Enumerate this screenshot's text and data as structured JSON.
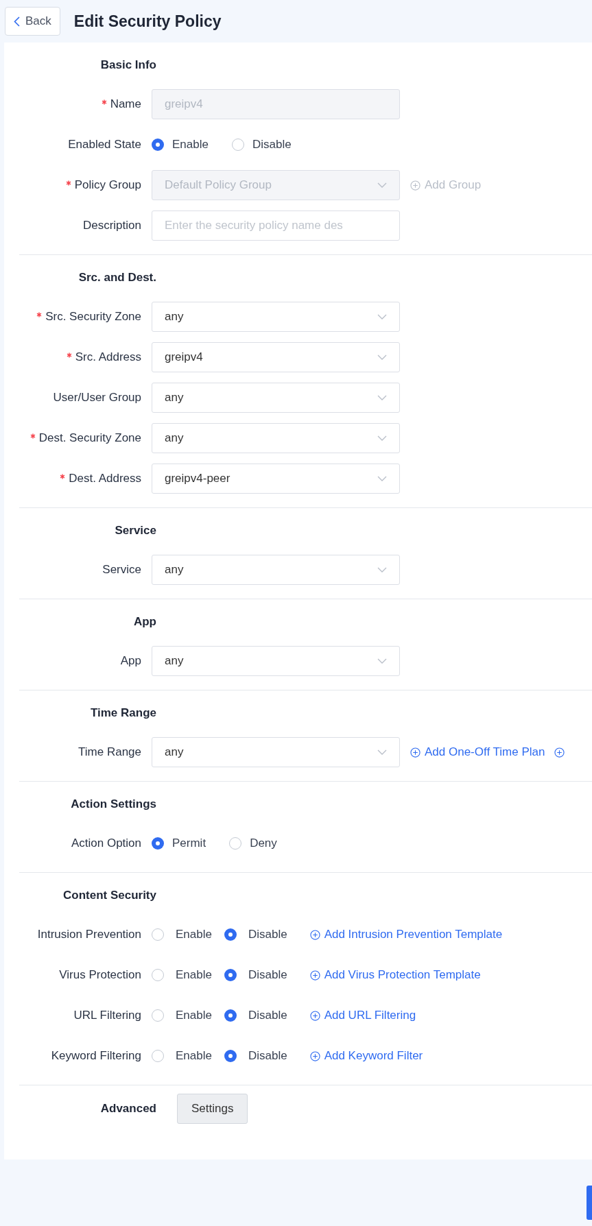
{
  "header": {
    "back": "Back",
    "title": "Edit Security Policy"
  },
  "sections": [
    {
      "kind": "form",
      "title": "Basic Info",
      "rows": [
        {
          "kind": "text",
          "label": "Name",
          "required": true,
          "value": "greipv4",
          "disabled": true
        },
        {
          "kind": "radio",
          "label": "Enabled State",
          "required": false,
          "options": [
            {
              "label": "Enable",
              "selected": true
            },
            {
              "label": "Disable",
              "selected": false
            }
          ]
        },
        {
          "kind": "select",
          "label": "Policy Group",
          "required": true,
          "value": "Default Policy Group",
          "disabled": true,
          "links": [
            {
              "kind": "link",
              "label": "Add Group",
              "disabled": true
            }
          ]
        },
        {
          "kind": "text",
          "label": "Description",
          "required": false,
          "placeholder": "Enter the security policy name des"
        }
      ]
    },
    {
      "kind": "form",
      "title": "Src. and Dest.",
      "rows": [
        {
          "kind": "select",
          "label": "Src. Security Zone",
          "required": true,
          "value": "any",
          "disabled": false
        },
        {
          "kind": "select",
          "label": "Src. Address",
          "required": true,
          "value": "greipv4",
          "disabled": false
        },
        {
          "kind": "select",
          "label": "User/User Group",
          "required": false,
          "value": "any",
          "disabled": false
        },
        {
          "kind": "select",
          "label": "Dest. Security Zone",
          "required": true,
          "value": "any",
          "disabled": false
        },
        {
          "kind": "select",
          "label": "Dest. Address",
          "required": true,
          "value": "greipv4-peer",
          "disabled": false
        }
      ]
    },
    {
      "kind": "form",
      "title": "Service",
      "rows": [
        {
          "kind": "select",
          "label": "Service",
          "required": false,
          "value": "any",
          "disabled": false
        }
      ]
    },
    {
      "kind": "form",
      "title": "App",
      "rows": [
        {
          "kind": "select",
          "label": "App",
          "required": false,
          "value": "any",
          "disabled": false
        }
      ]
    },
    {
      "kind": "form",
      "title": "Time Range",
      "rows": [
        {
          "kind": "select",
          "label": "Time Range",
          "required": false,
          "value": "any",
          "disabled": false,
          "links": [
            {
              "kind": "link",
              "label": "Add One-Off Time Plan",
              "disabled": false
            },
            {
              "kind": "icon",
              "disabled": false
            }
          ]
        }
      ]
    },
    {
      "kind": "form",
      "title": "Action Settings",
      "rows": [
        {
          "kind": "radio",
          "label": "Action Option",
          "required": false,
          "options": [
            {
              "label": "Permit",
              "selected": true
            },
            {
              "label": "Deny",
              "selected": false
            }
          ]
        }
      ]
    },
    {
      "kind": "form",
      "title": "Content Security",
      "rows": [
        {
          "kind": "radio",
          "label": "Intrusion Prevention",
          "required": false,
          "options": [
            {
              "label": "Enable",
              "selected": false
            },
            {
              "label": "Disable",
              "selected": true
            }
          ],
          "links": [
            {
              "kind": "link",
              "label": "Add Intrusion Prevention Template",
              "disabled": false
            }
          ]
        },
        {
          "kind": "radio",
          "label": "Virus Protection",
          "required": false,
          "options": [
            {
              "label": "Enable",
              "selected": false
            },
            {
              "label": "Disable",
              "selected": true
            }
          ],
          "links": [
            {
              "kind": "link",
              "label": "Add Virus Protection Template",
              "disabled": false
            }
          ]
        },
        {
          "kind": "radio",
          "label": "URL Filtering",
          "required": false,
          "options": [
            {
              "label": "Enable",
              "selected": false
            },
            {
              "label": "Disable",
              "selected": true
            }
          ],
          "links": [
            {
              "kind": "link",
              "label": "Add URL Filtering",
              "disabled": false
            }
          ]
        },
        {
          "kind": "radio",
          "label": "Keyword Filtering",
          "required": false,
          "options": [
            {
              "label": "Enable",
              "selected": false
            },
            {
              "label": "Disable",
              "selected": true
            }
          ],
          "links": [
            {
              "kind": "link",
              "label": "Add Keyword Filter",
              "disabled": false
            }
          ]
        }
      ]
    },
    {
      "kind": "inline",
      "title": "Advanced",
      "button": "Settings"
    }
  ]
}
